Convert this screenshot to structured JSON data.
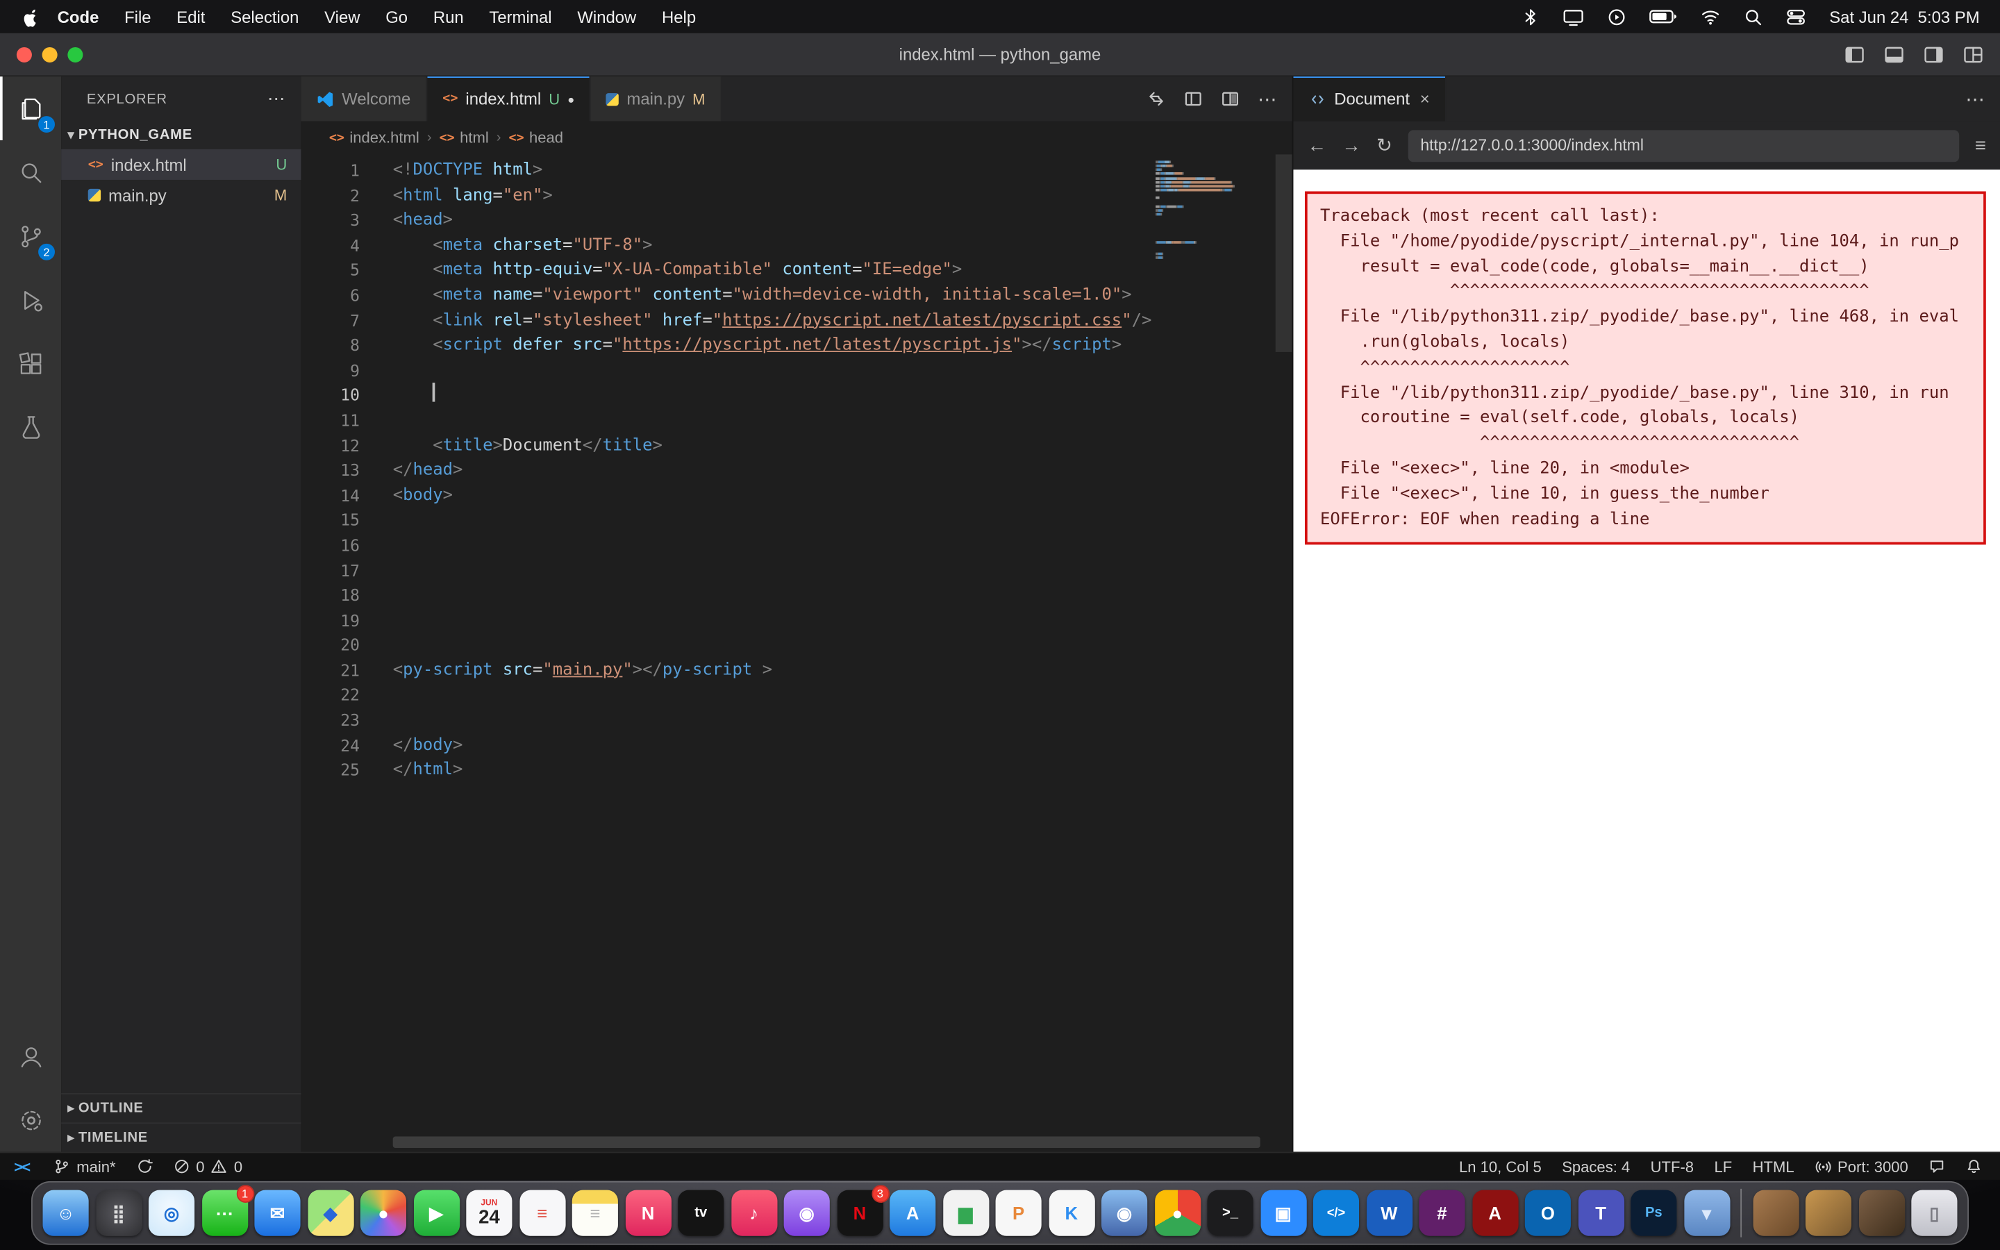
{
  "menu_bar": {
    "app_menu": "Code",
    "items": [
      "File",
      "Edit",
      "Selection",
      "View",
      "Go",
      "Run",
      "Terminal",
      "Window",
      "Help"
    ],
    "clock": "Sat Jun 24  5:03 PM"
  },
  "window": {
    "title": "index.html — python_game"
  },
  "icons": {
    "more": "⋯",
    "close": "×",
    "back": "←",
    "forward": "→",
    "reload": "↻",
    "menu": "≡",
    "chevron_down": "▾",
    "chevron_right": "▸",
    "modified_dot": "●",
    "remote": "><"
  },
  "activity_bar": {
    "explorer_badge": "1",
    "source_control_badge": "2"
  },
  "sidebar": {
    "title": "EXPLORER",
    "folder": "PYTHON_GAME",
    "files": [
      {
        "name": "index.html",
        "git": "U"
      },
      {
        "name": "main.py",
        "git": "M"
      }
    ],
    "outline": "OUTLINE",
    "timeline": "TIMELINE"
  },
  "editor": {
    "tabs": [
      {
        "label": "Welcome"
      },
      {
        "label": "index.html",
        "git": "U"
      },
      {
        "label": "main.py",
        "git": "M"
      }
    ],
    "breadcrumbs": [
      "index.html",
      "html",
      "head"
    ],
    "lines": [
      {
        "n": 1,
        "tokens": [
          [
            "p",
            "<!"
          ],
          [
            "t",
            "DOCTYPE"
          ],
          [
            "a",
            " html"
          ],
          [
            "p",
            ">"
          ]
        ]
      },
      {
        "n": 2,
        "tokens": [
          [
            "p",
            "<"
          ],
          [
            "t",
            "html"
          ],
          [
            "x",
            " "
          ],
          [
            "a",
            "lang"
          ],
          [
            "o",
            "="
          ],
          [
            "s",
            "\"en\""
          ],
          [
            "p",
            ">"
          ]
        ]
      },
      {
        "n": 3,
        "tokens": [
          [
            "p",
            "<"
          ],
          [
            "t",
            "head"
          ],
          [
            "p",
            ">"
          ]
        ]
      },
      {
        "n": 4,
        "tokens": [
          [
            "x",
            "    "
          ],
          [
            "p",
            "<"
          ],
          [
            "t",
            "meta"
          ],
          [
            "x",
            " "
          ],
          [
            "a",
            "charset"
          ],
          [
            "o",
            "="
          ],
          [
            "s",
            "\"UTF-8\""
          ],
          [
            "p",
            ">"
          ]
        ]
      },
      {
        "n": 5,
        "tokens": [
          [
            "x",
            "    "
          ],
          [
            "p",
            "<"
          ],
          [
            "t",
            "meta"
          ],
          [
            "x",
            " "
          ],
          [
            "a",
            "http-equiv"
          ],
          [
            "o",
            "="
          ],
          [
            "s",
            "\"X-UA-Compatible\""
          ],
          [
            "x",
            " "
          ],
          [
            "a",
            "content"
          ],
          [
            "o",
            "="
          ],
          [
            "s",
            "\"IE=edge\""
          ],
          [
            "p",
            ">"
          ]
        ]
      },
      {
        "n": 6,
        "tokens": [
          [
            "x",
            "    "
          ],
          [
            "p",
            "<"
          ],
          [
            "t",
            "meta"
          ],
          [
            "x",
            " "
          ],
          [
            "a",
            "name"
          ],
          [
            "o",
            "="
          ],
          [
            "s",
            "\"viewport\""
          ],
          [
            "x",
            " "
          ],
          [
            "a",
            "content"
          ],
          [
            "o",
            "="
          ],
          [
            "s",
            "\"width=device-width, initial-scale=1.0\""
          ],
          [
            "p",
            ">"
          ]
        ]
      },
      {
        "n": 7,
        "tokens": [
          [
            "x",
            "    "
          ],
          [
            "p",
            "<"
          ],
          [
            "t",
            "link"
          ],
          [
            "x",
            " "
          ],
          [
            "a",
            "rel"
          ],
          [
            "o",
            "="
          ],
          [
            "s",
            "\"stylesheet\""
          ],
          [
            "x",
            " "
          ],
          [
            "a",
            "href"
          ],
          [
            "o",
            "="
          ],
          [
            "s",
            "\""
          ],
          [
            "u",
            "https://pyscript.net/latest/pyscript.css"
          ],
          [
            "s",
            "\""
          ],
          [
            "p",
            "/>"
          ]
        ]
      },
      {
        "n": 8,
        "tokens": [
          [
            "x",
            "    "
          ],
          [
            "p",
            "<"
          ],
          [
            "t",
            "script"
          ],
          [
            "x",
            " "
          ],
          [
            "a",
            "defer"
          ],
          [
            "x",
            " "
          ],
          [
            "a",
            "src"
          ],
          [
            "o",
            "="
          ],
          [
            "s",
            "\""
          ],
          [
            "u",
            "https://pyscript.net/latest/pyscript.js"
          ],
          [
            "s",
            "\""
          ],
          [
            "p",
            ">"
          ],
          [
            "p",
            "</"
          ],
          [
            "t",
            "script"
          ],
          [
            "p",
            ">"
          ]
        ]
      },
      {
        "n": 9,
        "tokens": []
      },
      {
        "n": 10,
        "tokens": [
          [
            "x",
            "    "
          ]
        ],
        "cursor": true,
        "active": true
      },
      {
        "n": 11,
        "tokens": []
      },
      {
        "n": 12,
        "tokens": [
          [
            "x",
            "    "
          ],
          [
            "p",
            "<"
          ],
          [
            "t",
            "title"
          ],
          [
            "p",
            ">"
          ],
          [
            "x",
            "Document"
          ],
          [
            "p",
            "</"
          ],
          [
            "t",
            "title"
          ],
          [
            "p",
            ">"
          ]
        ]
      },
      {
        "n": 13,
        "tokens": [
          [
            "p",
            "</"
          ],
          [
            "t",
            "head"
          ],
          [
            "p",
            ">"
          ]
        ]
      },
      {
        "n": 14,
        "tokens": [
          [
            "p",
            "<"
          ],
          [
            "t",
            "body"
          ],
          [
            "p",
            ">"
          ]
        ]
      },
      {
        "n": 15,
        "tokens": []
      },
      {
        "n": 16,
        "tokens": []
      },
      {
        "n": 17,
        "tokens": []
      },
      {
        "n": 18,
        "tokens": []
      },
      {
        "n": 19,
        "tokens": []
      },
      {
        "n": 20,
        "tokens": []
      },
      {
        "n": 21,
        "tokens": [
          [
            "p",
            "<"
          ],
          [
            "t",
            "py-script"
          ],
          [
            "x",
            " "
          ],
          [
            "a",
            "src"
          ],
          [
            "o",
            "="
          ],
          [
            "s",
            "\""
          ],
          [
            "u",
            "main.py"
          ],
          [
            "s",
            "\""
          ],
          [
            "p",
            ">"
          ],
          [
            "p",
            "</"
          ],
          [
            "t",
            "py-script"
          ],
          [
            "x",
            " "
          ],
          [
            "p",
            ">"
          ]
        ]
      },
      {
        "n": 22,
        "tokens": []
      },
      {
        "n": 23,
        "tokens": []
      },
      {
        "n": 24,
        "tokens": [
          [
            "p",
            "</"
          ],
          [
            "t",
            "body"
          ],
          [
            "p",
            ">"
          ]
        ]
      },
      {
        "n": 25,
        "tokens": [
          [
            "p",
            "</"
          ],
          [
            "t",
            "html"
          ],
          [
            "p",
            ">"
          ]
        ]
      }
    ]
  },
  "preview": {
    "tab": "Document",
    "url": "http://127.0.0.1:3000/index.html",
    "traceback": [
      "Traceback (most recent call last):",
      "  File \"/home/pyodide/pyscript/_internal.py\", line 104, in run_p",
      "    result = eval_code(code, globals=__main__.__dict__)",
      "             ^^^^^^^^^^^^^^^^^^^^^^^^^^^^^^^^^^^^^^^^^^",
      "  File \"/lib/python311.zip/_pyodide/_base.py\", line 468, in eval",
      "    .run(globals, locals)",
      "    ^^^^^^^^^^^^^^^^^^^^^",
      "  File \"/lib/python311.zip/_pyodide/_base.py\", line 310, in run",
      "    coroutine = eval(self.code, globals, locals)",
      "                ^^^^^^^^^^^^^^^^^^^^^^^^^^^^^^^^",
      "  File \"<exec>\", line 20, in <module>",
      "  File \"<exec>\", line 10, in guess_the_number",
      "EOFError: EOF when reading a line"
    ]
  },
  "status_bar": {
    "branch": "main*",
    "errors": "0",
    "warnings": "0",
    "line_col": "Ln 10, Col 5",
    "indent": "Spaces: 4",
    "encoding": "UTF-8",
    "eol": "LF",
    "language": "HTML",
    "port": "Port: 3000"
  },
  "colors": {
    "accent": "#0078d4",
    "active_tab_border": "#3b99fc",
    "git_untracked": "#73c991",
    "git_modified": "#e2c08d",
    "error_background": "#ffdede",
    "error_border": "#d40e0e"
  },
  "dock": {
    "icons": [
      {
        "name": "finder",
        "bg": "linear-gradient(180deg,#8ec9f5,#1f6fd4)",
        "glyph": "☺",
        "color": "#fff"
      },
      {
        "name": "launchpad",
        "bg": "radial-gradient(circle,#58585e,#2e2e31)",
        "glyph": "⣿",
        "color": "#ddd"
      },
      {
        "name": "safari",
        "bg": "radial-gradient(circle at 50% 40%,#f2f9ff,#cfe8fa)",
        "glyph": "◎",
        "color": "#1f6fd4"
      },
      {
        "name": "messages",
        "bg": "linear-gradient(180deg,#6be36b,#17b317)",
        "glyph": "⋯",
        "color": "#fff",
        "badge": "1"
      },
      {
        "name": "mail",
        "bg": "linear-gradient(180deg,#6ab8ff,#1a6fe0)",
        "glyph": "✉",
        "color": "#fff"
      },
      {
        "name": "maps",
        "bg": "linear-gradient(135deg,#9be37b 50%,#f7e27a 50%)",
        "glyph": "◆",
        "color": "#2b66d9"
      },
      {
        "name": "photos",
        "bg": "conic-gradient(#f5b642,#e84f3d,#b05ce0,#4a7bea,#41c46f,#f5b642)",
        "glyph": "●",
        "color": "#fff"
      },
      {
        "name": "facetime",
        "bg": "linear-gradient(180deg,#57e06b,#1fae37)",
        "glyph": "▶",
        "color": "#fff"
      },
      {
        "name": "calendar",
        "bg": "#f7f7f9",
        "month": "JUN",
        "day": "24"
      },
      {
        "name": "reminders",
        "bg": "#f7f7f9",
        "glyph": "≡",
        "color": "#e2574c"
      },
      {
        "name": "notes",
        "bg": "linear-gradient(180deg,#f8d657 30%,#fdfdf7 30%)",
        "glyph": "≡",
        "color": "#b5b5b5"
      },
      {
        "name": "news",
        "bg": "linear-gradient(180deg,#fb637e,#e0265e)",
        "glyph": "N",
        "color": "#fff"
      },
      {
        "name": "tv",
        "bg": "#141414",
        "glyph": "tv",
        "color": "#fff",
        "size": 11
      },
      {
        "name": "music",
        "bg": "linear-gradient(180deg,#fb5c74,#e0265e)",
        "glyph": "♪",
        "color": "#fff"
      },
      {
        "name": "podcasts",
        "bg": "linear-gradient(180deg,#b08df7,#7d3fe0)",
        "glyph": "◉",
        "color": "#fff"
      },
      {
        "name": "netflix",
        "bg": "#141414",
        "glyph": "N",
        "color": "#e50914",
        "badge": "3"
      },
      {
        "name": "app-store",
        "bg": "linear-gradient(180deg,#59b7f7,#1f7ae0)",
        "glyph": "A",
        "color": "#fff"
      },
      {
        "name": "numbers",
        "bg": "#f2f2f2",
        "glyph": "▆",
        "color": "#34a853"
      },
      {
        "name": "pages",
        "bg": "#f7f7f7",
        "glyph": "P",
        "color": "#e8883a"
      },
      {
        "name": "keynote",
        "bg": "#f7f7f7",
        "glyph": "K",
        "color": "#2f8ef0"
      },
      {
        "name": "photo-booth",
        "bg": "linear-gradient(180deg,#88bbee,#4466aa)",
        "glyph": "◉",
        "color": "#fff"
      },
      {
        "name": "chrome",
        "bg": "conic-gradient(#ea4335 0 120deg,#34a853 120deg 240deg,#fbbc05 240deg 360deg)",
        "glyph": "●",
        "color": "#fff"
      },
      {
        "name": "terminal",
        "bg": "#1c1c1e",
        "glyph": ">_",
        "color": "#fff",
        "size": 11
      },
      {
        "name": "zoom",
        "bg": "#2d8cff",
        "glyph": "▣",
        "color": "#fff"
      },
      {
        "name": "vscode",
        "bg": "#0d7ed9",
        "glyph": "</>",
        "color": "#fff",
        "size": 10
      },
      {
        "name": "word",
        "bg": "#1b5ebe",
        "glyph": "W",
        "color": "#fff"
      },
      {
        "name": "slack",
        "bg": "#611f69",
        "glyph": "#",
        "color": "#fff"
      },
      {
        "name": "acrobat",
        "bg": "#8e1111",
        "glyph": "A",
        "color": "#fff"
      },
      {
        "name": "outlook",
        "bg": "#0a64b0",
        "glyph": "O",
        "color": "#fff"
      },
      {
        "name": "teams",
        "bg": "#4b53bc",
        "glyph": "T",
        "color": "#fff"
      },
      {
        "name": "photoshop",
        "bg": "#0b1d33",
        "glyph": "Ps",
        "color": "#56b6f7",
        "size": 11
      },
      {
        "name": "folder",
        "bg": "linear-gradient(180deg,#8fb7e8,#5a86c2)",
        "glyph": "▾",
        "color": "#dce9fb"
      },
      {
        "sep": true
      },
      {
        "name": "photo-thumb-1",
        "bg": "linear-gradient(135deg,#a87b4f,#6b4a2a)"
      },
      {
        "name": "photo-thumb-2",
        "bg": "linear-gradient(135deg,#c9974f,#7a5a31)"
      },
      {
        "name": "photo-thumb-3",
        "bg": "linear-gradient(135deg,#7d6046,#3e2e1c)"
      },
      {
        "name": "trash",
        "bg": "linear-gradient(180deg,#e9e9ee,#bfc0c8)",
        "glyph": "▯",
        "color": "#7a7a82"
      }
    ]
  }
}
